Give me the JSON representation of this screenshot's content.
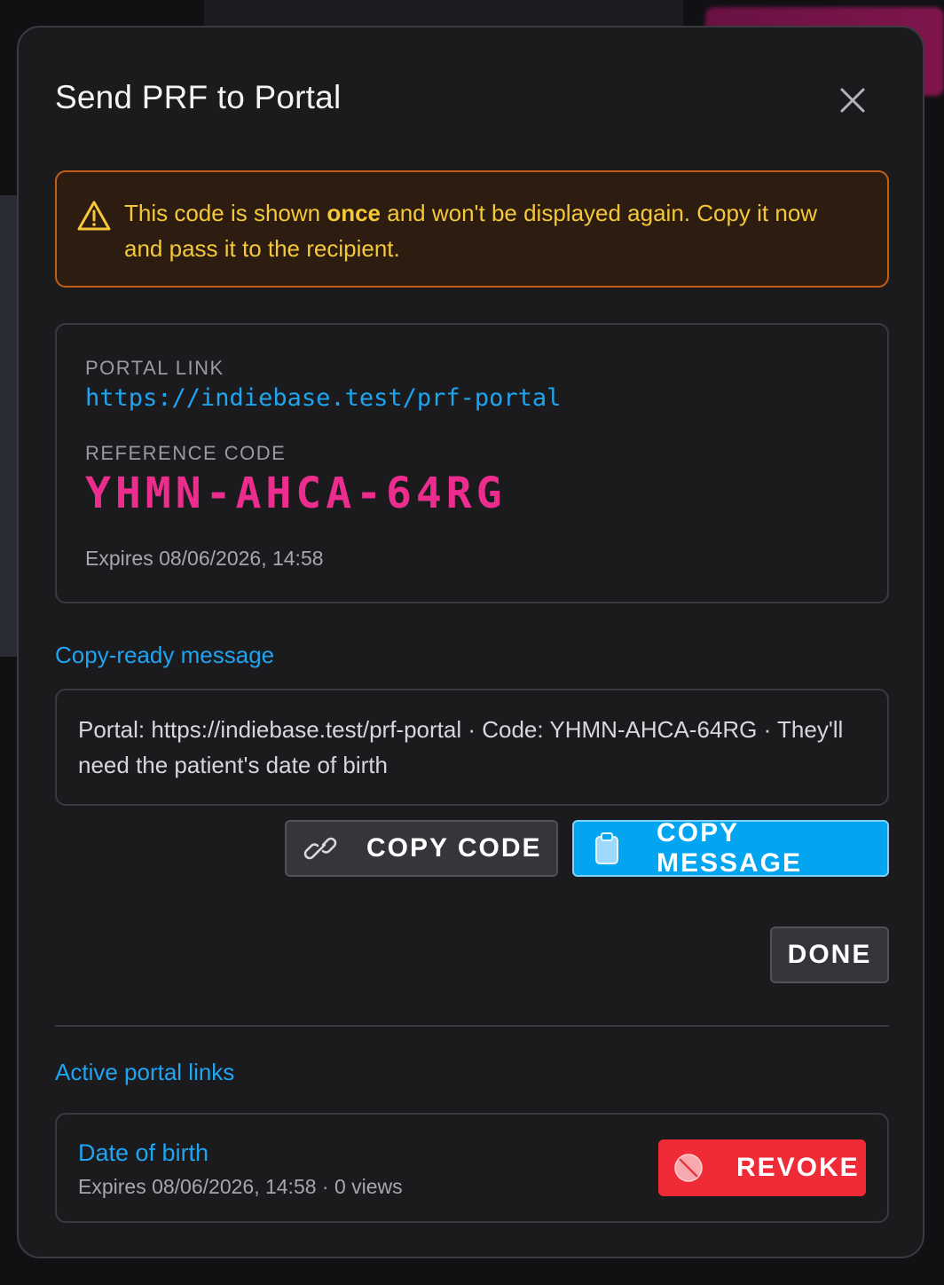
{
  "dialog": {
    "title": "Send PRF to Portal"
  },
  "warning": {
    "text_before": "This code is shown ",
    "text_bold": "once",
    "text_after": " and won't be displayed again. Copy it now and pass it to the recipient."
  },
  "code_card": {
    "portal_link_label": "PORTAL LINK",
    "portal_link": "https://indiebase.test/prf-portal",
    "reference_code_label": "REFERENCE CODE",
    "reference_code": "YHMN-AHCA-64RG",
    "expires": "Expires 08/06/2026, 14:58"
  },
  "copy_message": {
    "heading": "Copy-ready message",
    "text": "Portal: https://indiebase.test/prf-portal · Code: YHMN-AHCA-64RG · They'll need the patient's date of birth"
  },
  "buttons": {
    "copy_code": "COPY CODE",
    "copy_message": "COPY MESSAGE",
    "done": "DONE"
  },
  "active_links": {
    "heading": "Active portal links",
    "items": [
      {
        "name": "Date of birth",
        "meta": "Expires 08/06/2026, 14:58 · 0 views",
        "revoke_label": "REVOKE"
      }
    ]
  },
  "icons": {
    "close": "close-icon",
    "warning": "warning-icon",
    "link": "link-icon",
    "clipboard": "clipboard-icon",
    "revoke": "ban-icon"
  },
  "colors": {
    "accent": "#1ea4f1",
    "code": "#ec2d8e",
    "warning_text": "#f5c73a",
    "warning_border": "#c25f17",
    "danger": "#ef2b37",
    "primary_button": "#03a4f0"
  }
}
